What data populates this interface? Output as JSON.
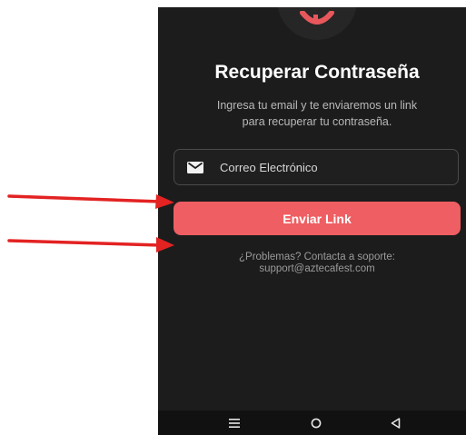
{
  "screen": {
    "title": "Recuperar Contraseña",
    "subtitle_line1": "Ingresa tu email y te enviaremos un link",
    "subtitle_line2": "para recuperar tu contraseña."
  },
  "email_field": {
    "placeholder": "Correo Electrónico",
    "value": "",
    "icon": "mail-icon"
  },
  "send_button": {
    "label": "Enviar Link"
  },
  "support": {
    "line1": "¿Problemas? Contacta a soporte:",
    "line2": "support@aztecafest.com"
  },
  "navbar": {
    "items": [
      "menu-icon",
      "home-icon",
      "back-icon"
    ]
  },
  "colors": {
    "background": "#1c1c1c",
    "accent": "#ee5e62",
    "annotation_arrow": "#e32222"
  }
}
